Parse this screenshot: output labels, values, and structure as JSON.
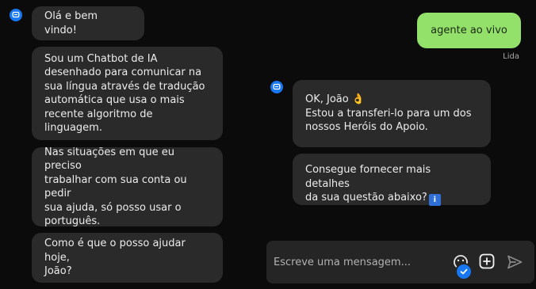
{
  "bot_messages_left": [
    "Olá e bem vindo!",
    "Sou um Chatbot de IA\ndesenhado para comunicar na\nsua língua através de tradução\nautomática que usa o mais\nrecente algoritmo de linguagem.",
    "Nas situações em que eu preciso\ntrabalhar com sua conta ou pedir\nsua ajuda, só posso usar o\nportuguês.",
    "Como é que o posso ajudar hoje,\nJoão?"
  ],
  "user_message": {
    "text": "agente ao vivo",
    "status": "Lida"
  },
  "bot_messages_right": {
    "handoff": "OK, João 👌\nEstou a transferi-lo para um dos\nnossos Heróis do Apoio.",
    "followup": "Consegue fornecer mais detalhes\nda sua questão abaixo?",
    "followup_badge": "i"
  },
  "composer": {
    "placeholder": "Escreve uma mensagem..."
  },
  "colors": {
    "background": "#0b0b0b",
    "bot_bubble": "#2a2a2a",
    "user_bubble": "#93e06a",
    "accent": "#1877f2"
  },
  "icons": {
    "bot_avatar": "chat-bubble-icon",
    "emoji": "smiley-icon",
    "attach": "plus-square-icon",
    "send": "send-arrow-icon",
    "check": "checkmark-icon"
  }
}
